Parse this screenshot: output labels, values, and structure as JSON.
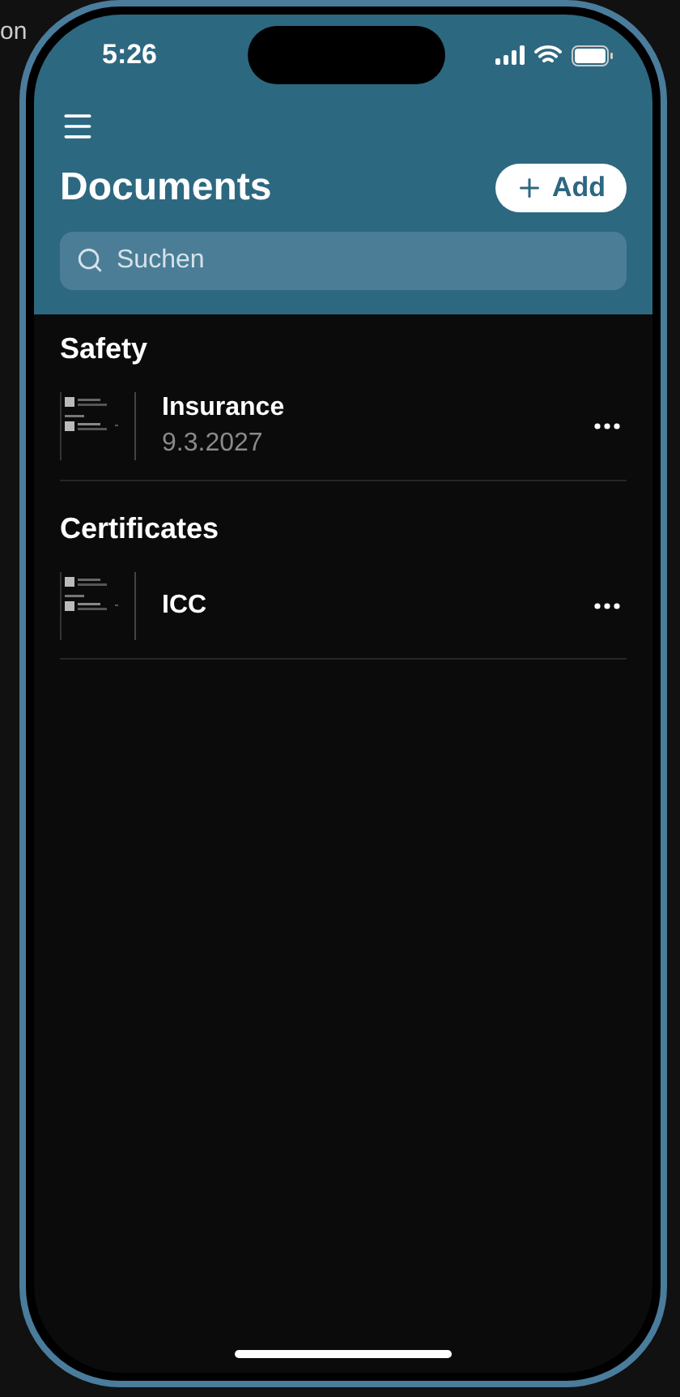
{
  "background_text": "on",
  "status_bar": {
    "time": "5:26"
  },
  "header": {
    "title": "Documents",
    "add_button": {
      "label": "Add"
    },
    "search": {
      "placeholder": "Suchen"
    }
  },
  "sections": [
    {
      "title": "Safety",
      "items": [
        {
          "name": "Insurance",
          "date": "9.3.2027"
        }
      ]
    },
    {
      "title": "Certificates",
      "items": [
        {
          "name": "ICC"
        }
      ]
    }
  ]
}
